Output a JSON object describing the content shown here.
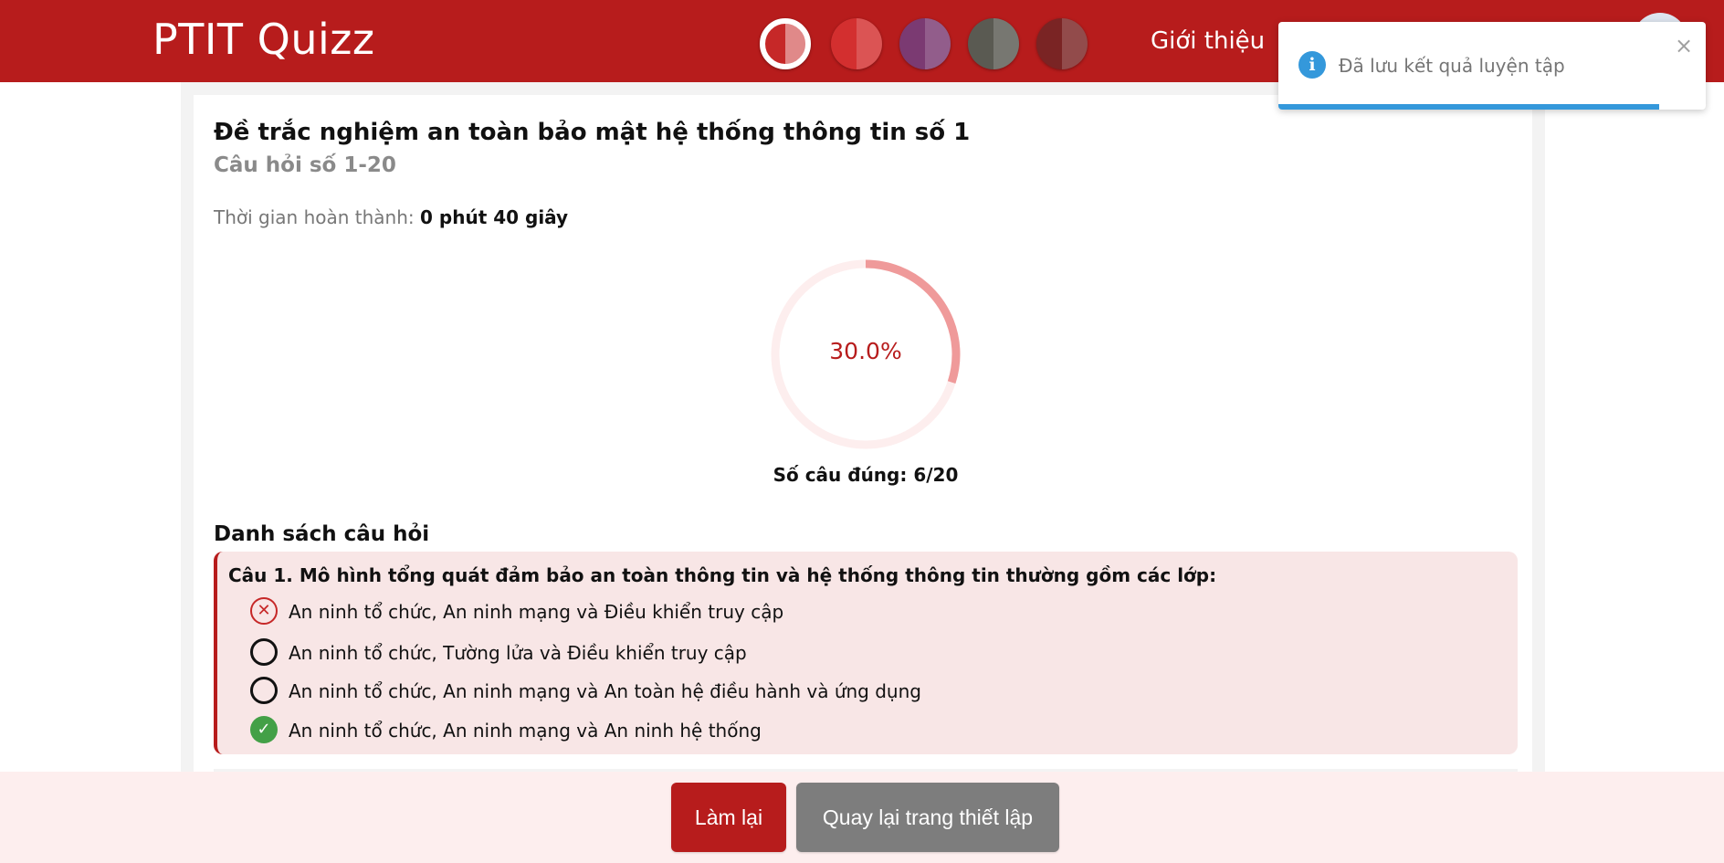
{
  "header": {
    "brand": "PTIT Quizz",
    "nav_about": "Giới thiệu",
    "themes": [
      {
        "name": "theme-red-white",
        "color": "#c62828",
        "active": true
      },
      {
        "name": "theme-red",
        "color": "#d32f2f",
        "active": false
      },
      {
        "name": "theme-purple",
        "color": "#7b3a72",
        "active": false
      },
      {
        "name": "theme-gray",
        "color": "#5a5a52",
        "active": false
      },
      {
        "name": "theme-maroon",
        "color": "#7a2424",
        "active": false
      }
    ]
  },
  "toast": {
    "message": "Đã lưu kết quả luyện tập",
    "close_glyph": "×",
    "info_glyph": "i",
    "progress": 0.89
  },
  "result": {
    "title": "Đề trắc nghiệm an toàn bảo mật hệ thống thông tin số 1",
    "subtitle": "Câu hỏi số 1-20",
    "time_label": "Thời gian hoàn thành:",
    "time_value": "0 phút 40 giây",
    "score_percent_label": "30.0%",
    "score_fraction": 0.3,
    "correct_count_label": "Số câu đúng: 6/20",
    "accent_color": "#b71c1c"
  },
  "questions": {
    "heading": "Danh sách câu hỏi",
    "items": [
      {
        "text": "Câu 1. Mô hình tổng quát đảm bảo an toàn thông tin và hệ thống thông tin thường gồm các lớp:",
        "options": [
          {
            "text": "An ninh tổ chức, An ninh mạng và Điều khiển truy cập",
            "state": "wrong"
          },
          {
            "text": "An ninh tổ chức, Tường lửa và Điều khiển truy cập",
            "state": "blank"
          },
          {
            "text": "An ninh tổ chức, An ninh mạng và An toàn hệ điều hành và ứng dụng",
            "state": "blank"
          },
          {
            "text": "An ninh tổ chức, An ninh mạng và An ninh hệ thống",
            "state": "correct"
          }
        ]
      }
    ]
  },
  "footer": {
    "retry_label": "Làm lại",
    "back_label": "Quay lại trang thiết lập"
  }
}
